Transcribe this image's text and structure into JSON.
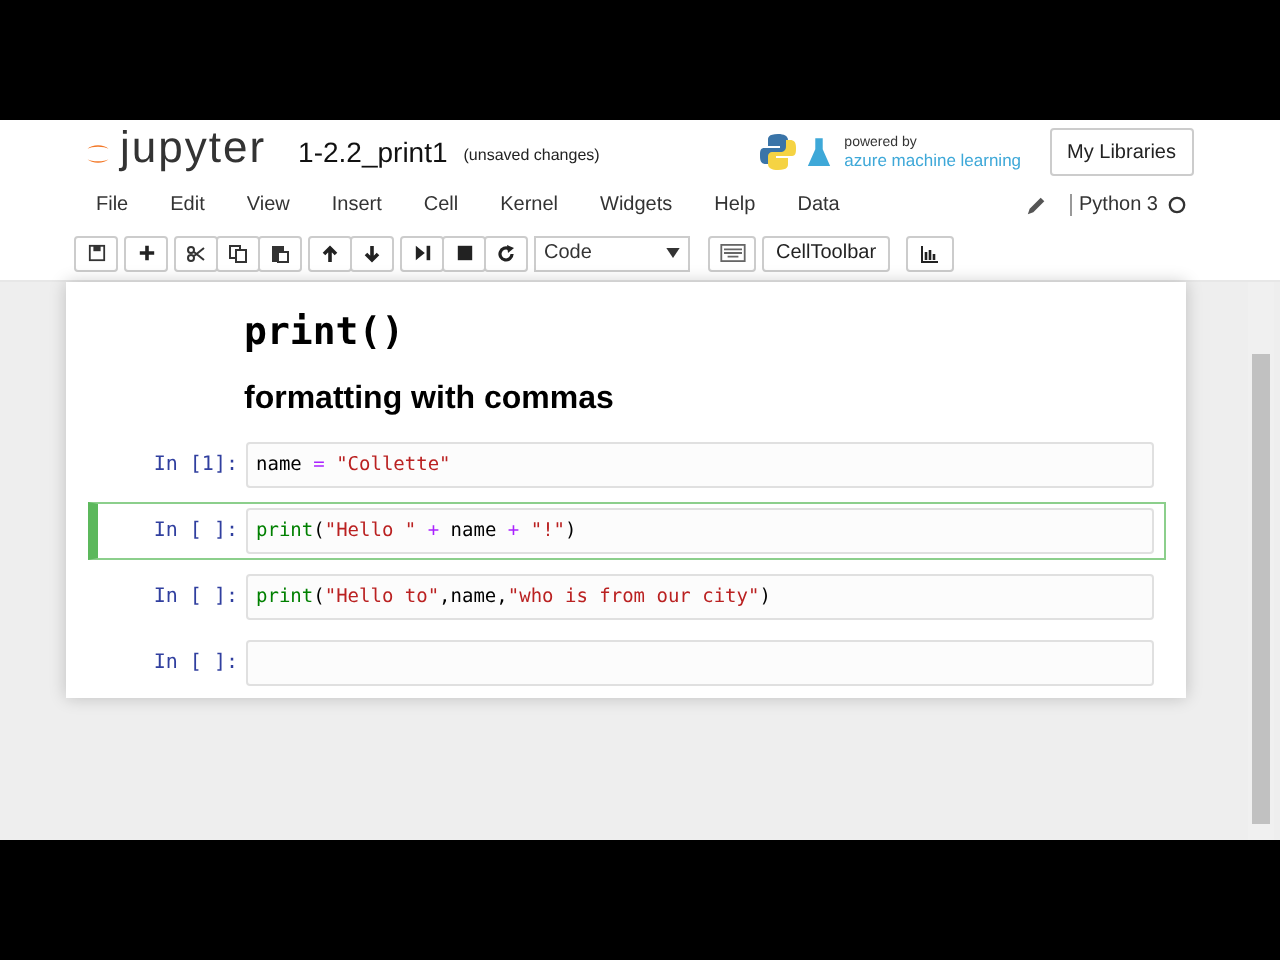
{
  "header": {
    "logo_text": "jupyter",
    "notebook_title": "1-2.2_print1",
    "save_status": "(unsaved changes)",
    "powered_by": "powered by",
    "powered_name": "azure machine learning",
    "libraries_button": "My Libraries"
  },
  "menu": [
    "File",
    "Edit",
    "View",
    "Insert",
    "Cell",
    "Kernel",
    "Widgets",
    "Help",
    "Data"
  ],
  "kernel": {
    "name": "Python 3"
  },
  "toolbar": {
    "cell_type": "Code",
    "celltoolbar_button": "CellToolbar"
  },
  "cells": [
    {
      "kind": "heading1",
      "text": "print()"
    },
    {
      "kind": "heading2",
      "text": "formatting with commas"
    },
    {
      "kind": "code",
      "prompt": "In [1]:",
      "selected": false,
      "tokens": [
        {
          "kind": "name",
          "text": "name "
        },
        {
          "kind": "op",
          "text": "= "
        },
        {
          "kind": "string",
          "text": "\"Collette\""
        }
      ]
    },
    {
      "kind": "code",
      "prompt": "In [ ]:",
      "selected": true,
      "tokens": [
        {
          "kind": "builtin",
          "text": "print"
        },
        {
          "kind": "name",
          "text": "("
        },
        {
          "kind": "string",
          "text": "\"Hello \" "
        },
        {
          "kind": "op",
          "text": "+"
        },
        {
          "kind": "name",
          "text": " name "
        },
        {
          "kind": "op",
          "text": "+ "
        },
        {
          "kind": "string",
          "text": "\"!\""
        },
        {
          "kind": "name",
          "text": ")"
        }
      ]
    },
    {
      "kind": "code",
      "prompt": "In [ ]:",
      "selected": false,
      "tokens": [
        {
          "kind": "builtin",
          "text": "print"
        },
        {
          "kind": "name",
          "text": "("
        },
        {
          "kind": "string",
          "text": "\"Hello to\""
        },
        {
          "kind": "name",
          "text": ",name,"
        },
        {
          "kind": "string",
          "text": "\"who is from our city\""
        },
        {
          "kind": "name",
          "text": ")"
        }
      ]
    },
    {
      "kind": "code",
      "prompt": "In [ ]:",
      "selected": false
    }
  ]
}
